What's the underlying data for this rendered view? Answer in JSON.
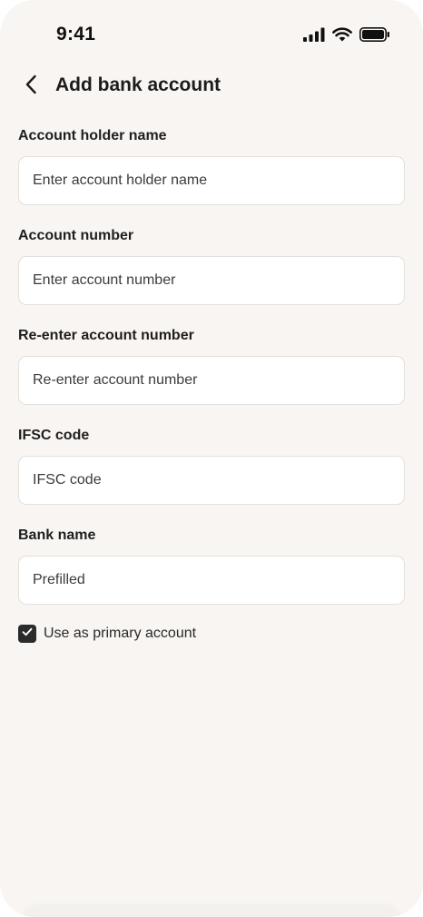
{
  "status_bar": {
    "time": "9:41",
    "icons": [
      "cellular-signal-icon",
      "wifi-icon",
      "battery-icon"
    ]
  },
  "header": {
    "back_icon": "chevron-left-icon",
    "title": "Add bank account"
  },
  "form": {
    "fields": [
      {
        "label": "Account holder name",
        "placeholder": "Enter account holder name",
        "value": ""
      },
      {
        "label": "Account number",
        "placeholder": "Enter account number",
        "value": ""
      },
      {
        "label": "Re-enter account number",
        "placeholder": "Re-enter account number",
        "value": ""
      },
      {
        "label": "IFSC code",
        "placeholder": "IFSC code",
        "value": ""
      },
      {
        "label": "Bank name",
        "placeholder": "Prefilled",
        "value": ""
      }
    ],
    "primary_checkbox": {
      "label": "Use as primary account",
      "checked": true
    }
  },
  "colors": {
    "background": "#f8f5f2",
    "input_background": "#ffffff",
    "input_border": "#e3e0dc",
    "text": "#1c1c1c",
    "checkbox": "#2b2b2b"
  }
}
